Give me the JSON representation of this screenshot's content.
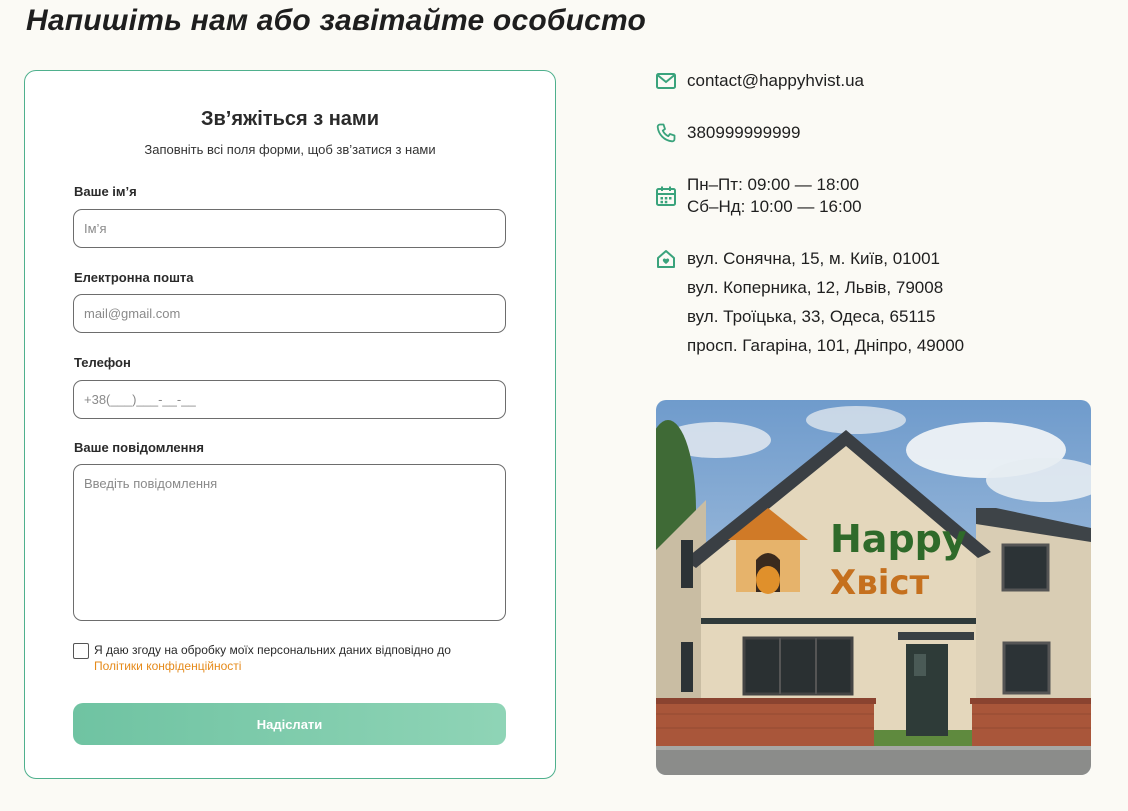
{
  "page": {
    "title": "Напишіть нам або завітайте особисто"
  },
  "form": {
    "title": "Зв’яжіться з нами",
    "subtitle": "Заповніть всі поля форми, щоб зв’затися з нами",
    "name_label": "Ваше ім’я",
    "name_placeholder": "Ім’я",
    "email_label": "Електронна пошта",
    "email_placeholder": "mail@gmail.com",
    "phone_label": "Телефон",
    "phone_placeholder": "+38(___)___-__-__",
    "message_label": "Ваше повідомлення",
    "message_placeholder": "Введіть повідомлення",
    "consent_text": "Я даю згоду на обробку моїх персональних даних відповідно до",
    "consent_link": "Політики конфіденційності",
    "submit_label": "Надіслати"
  },
  "contacts": {
    "email": "contact@happyhvist.ua",
    "phone": "380999999999",
    "hours_weekdays": "Пн–Пт: 09:00 — 18:00",
    "hours_weekend": "Сб–Нд: 10:00 — 16:00",
    "addresses": [
      "вул. Сонячна, 15, м. Київ, 01001",
      "вул. Коперника, 12, Львів, 79008",
      "вул. Троїцька, 33, Одеса, 65115",
      "просп. Гагаріна, 101, Дніпро, 49000"
    ]
  },
  "photo": {
    "sign_line1": "Happy",
    "sign_line2": "Хвіст"
  },
  "colors": {
    "accent": "#4fb08d",
    "link": "#e58a1a",
    "brand_green": "#2f6a2a",
    "brand_orange": "#c5701e"
  },
  "icons": [
    "mail-icon",
    "phone-icon",
    "calendar-icon",
    "home-heart-icon"
  ]
}
